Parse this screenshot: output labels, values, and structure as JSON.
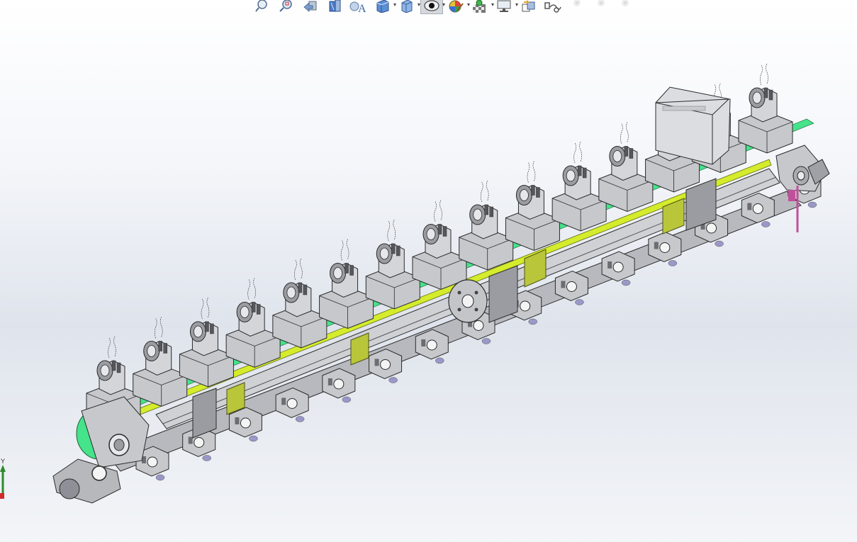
{
  "toolbar": {
    "buttons": [
      {
        "icon": "zoom-to-fit-icon",
        "label": ""
      },
      {
        "icon": "zoom-to-area-icon",
        "label": ""
      },
      {
        "icon": "previous-view-icon",
        "label": ""
      },
      {
        "icon": "section-view-icon",
        "label": ""
      },
      {
        "icon": "dynamic-annotation-views-icon",
        "label": "A"
      },
      {
        "icon": "view-orientation-icon",
        "label": ""
      },
      {
        "icon": "display-style-icon",
        "label": ""
      },
      {
        "icon": "hide-show-items-icon",
        "label": ""
      },
      {
        "icon": "edit-appearance-icon",
        "label": ""
      },
      {
        "icon": "apply-scene-icon",
        "label": ""
      },
      {
        "icon": "view-settings-icon",
        "label": ""
      },
      {
        "icon": "rotate-view-icon",
        "label": ""
      },
      {
        "icon": "link-icon",
        "label": ""
      },
      {
        "icon": "disabled-icon-1",
        "label": ""
      },
      {
        "icon": "disabled-icon-2",
        "label": ""
      },
      {
        "icon": "disabled-icon-3",
        "label": ""
      }
    ]
  },
  "triad": {
    "y_label": "Y"
  },
  "colors": {
    "part_gray": "#c6c8cc",
    "part_dark": "#8d9096",
    "shaft_yellow": "#d4ec2c",
    "pad_green": "#45e38a",
    "bracket_olive": "#b9c63a",
    "motor_gray": "#d8d9dc",
    "pink_tag": "#c0509a",
    "outline": "#2b2b2b"
  }
}
